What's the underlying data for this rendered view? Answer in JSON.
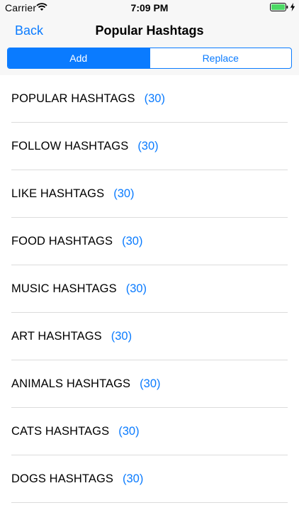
{
  "status_bar": {
    "carrier": "Carrier",
    "time": "7:09 PM"
  },
  "nav": {
    "back_label": "Back",
    "title": "Popular Hashtags"
  },
  "segments": [
    {
      "label": "Add",
      "selected": true
    },
    {
      "label": "Replace",
      "selected": false
    }
  ],
  "list": [
    {
      "label": "POPULAR HASHTAGS",
      "count": "(30)"
    },
    {
      "label": "FOLLOW HASHTAGS",
      "count": "(30)"
    },
    {
      "label": "LIKE HASHTAGS",
      "count": "(30)"
    },
    {
      "label": "FOOD HASHTAGS",
      "count": "(30)"
    },
    {
      "label": "MUSIC HASHTAGS",
      "count": "(30)"
    },
    {
      "label": "ART HASHTAGS",
      "count": "(30)"
    },
    {
      "label": "ANIMALS HASHTAGS",
      "count": "(30)"
    },
    {
      "label": "CATS HASHTAGS",
      "count": "(30)"
    },
    {
      "label": "DOGS HASHTAGS",
      "count": "(30)"
    }
  ],
  "icons": {
    "wifi": "wifi-icon",
    "battery": "battery-icon",
    "charging": "charging-bolt-icon"
  },
  "colors": {
    "accent": "#0a7bff",
    "header_background": "#f7f7f7",
    "separator": "#dcdcdc"
  }
}
